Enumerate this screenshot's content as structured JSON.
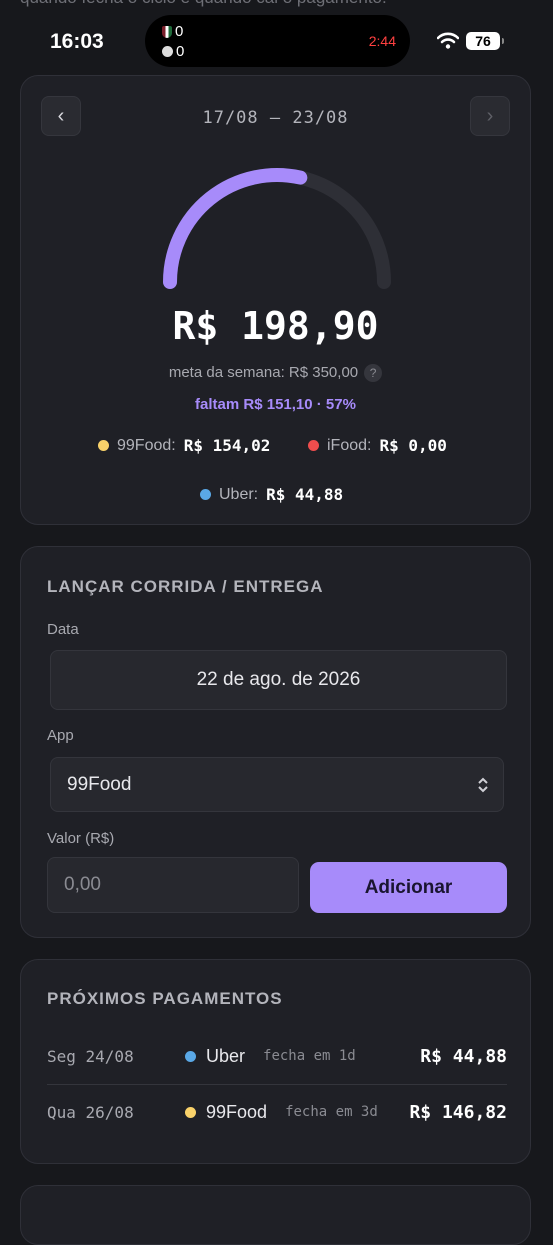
{
  "background_text": "quando fecha o ciclo e quando cai o pagamento.",
  "status_bar": {
    "time": "16:03",
    "battery": "76",
    "live_activity": {
      "team1_score": "0",
      "team2_score": "0",
      "match_clock": "2:44"
    }
  },
  "week_card": {
    "prev_label": "‹",
    "next_label": "›",
    "date_range": "17/08 – 23/08",
    "total": "R$ 198,90",
    "goal_text": "meta da semana: R$ 350,00",
    "help_label": "?",
    "remaining_text": "faltam R$ 151,10 · 57%",
    "progress_fraction": 0.57,
    "apps": [
      {
        "name": "99Food:",
        "value": "R$ 154,02",
        "color": "#f9d26a"
      },
      {
        "name": "iFood:",
        "value": "R$ 0,00",
        "color": "#ef4d4d"
      },
      {
        "name": "Uber:",
        "value": "R$ 44,88",
        "color": "#5aa8e6"
      }
    ]
  },
  "entry_card": {
    "title": "LANÇAR CORRIDA / ENTREGA",
    "date_label": "Data",
    "date_value": "22 de ago. de 2026",
    "app_label": "App",
    "app_value": "99Food",
    "amount_label": "Valor (R$)",
    "amount_placeholder": "0,00",
    "add_button": "Adicionar"
  },
  "payments_card": {
    "title": "PRÓXIMOS PAGAMENTOS",
    "rows": [
      {
        "date": "Seg 24/08",
        "app": "Uber",
        "color": "#5aa8e6",
        "due": "fecha em 1d",
        "value": "R$ 44,88"
      },
      {
        "date": "Qua 26/08",
        "app": "99Food",
        "color": "#f9d26a",
        "due": "fecha em 3d",
        "value": "R$ 146,82"
      }
    ]
  },
  "colors": {
    "accent": "#a78bfa",
    "track": "#2e2f36"
  }
}
